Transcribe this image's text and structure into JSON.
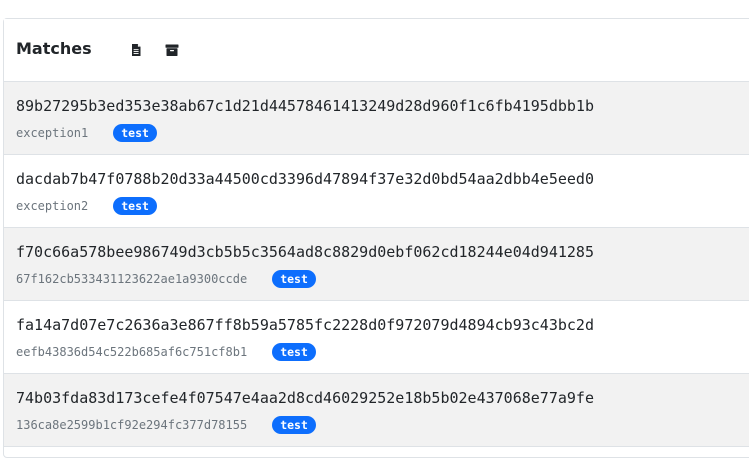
{
  "header": {
    "title": "Matches",
    "icons": [
      "file-text-icon",
      "archive-icon"
    ]
  },
  "colors": {
    "badge": "#0d6efd",
    "row_alt": "#f2f2f2",
    "border": "#dee2e6"
  },
  "matches": [
    {
      "hash": "89b27295b3ed353e38ab67c1d21d44578461413249d28d960f1c6fb4195dbb1b",
      "name": "exception1",
      "tag": "test"
    },
    {
      "hash": "dacdab7b47f0788b20d33a44500cd3396d47894f37e32d0bd54aa2dbb4e5eed0",
      "name": "exception2",
      "tag": "test"
    },
    {
      "hash": "f70c66a578bee986749d3cb5b5c3564ad8c8829d0ebf062cd18244e04d941285",
      "name": "67f162cb533431123622ae1a9300ccde",
      "tag": "test"
    },
    {
      "hash": "fa14a7d07e7c2636a3e867ff8b59a5785fc2228d0f972079d4894cb93c43bc2d",
      "name": "eefb43836d54c522b685af6c751cf8b1",
      "tag": "test"
    },
    {
      "hash": "74b03fda83d173cefe4f07547e4aa2d8cd46029252e18b5b02e437068e77a9fe",
      "name": "136ca8e2599b1cf92e294fc377d78155",
      "tag": "test"
    }
  ]
}
